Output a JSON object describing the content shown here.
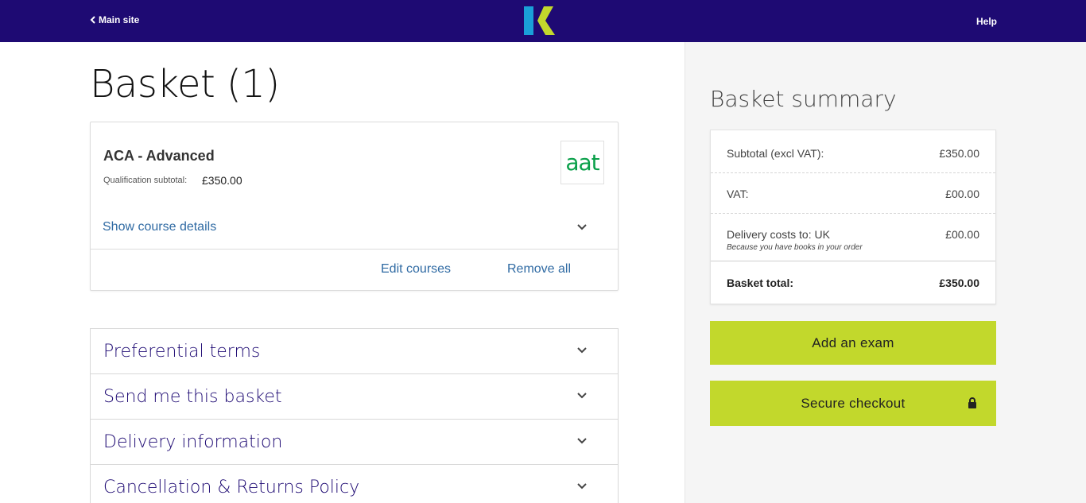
{
  "header": {
    "back_label": "Main site",
    "help_label": "Help",
    "colors": {
      "bar": "#1e0a73",
      "logo_blue": "#1aa0d8",
      "logo_lime": "#c2d82c"
    }
  },
  "page": {
    "title": "Basket (1)"
  },
  "course": {
    "name": "ACA - Advanced",
    "qual_label": "Qualification subtotal:",
    "qual_value": "£350.00",
    "logo_text": "aat",
    "show_details": "Show course details",
    "edit_label": "Edit courses",
    "remove_label": "Remove all"
  },
  "accordion": [
    {
      "label": "Preferential terms"
    },
    {
      "label": "Send me this basket"
    },
    {
      "label": "Delivery information"
    },
    {
      "label": "Cancellation & Returns Policy"
    }
  ],
  "summary": {
    "title": "Basket summary",
    "subtotal_label": "Subtotal (excl VAT):",
    "subtotal_value": "£350.00",
    "vat_label": "VAT:",
    "vat_value": "£00.00",
    "delivery_label": "Delivery costs to: UK",
    "delivery_note": "Because you have books in your order",
    "delivery_value": "£00.00",
    "total_label": "Basket total:",
    "total_value": "£350.00"
  },
  "buttons": {
    "add_exam": "Add an exam",
    "checkout": "Secure checkout",
    "color": "#c2d82c"
  }
}
